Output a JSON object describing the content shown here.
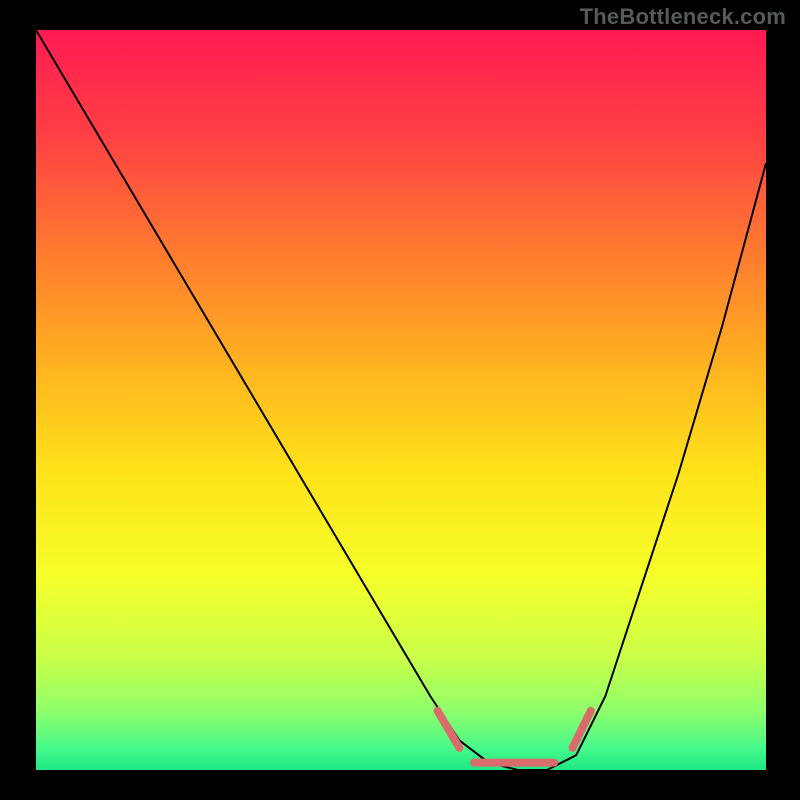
{
  "watermark": "TheBottleneck.com",
  "chart_data": {
    "type": "line",
    "title": "",
    "xlabel": "",
    "ylabel": "",
    "x_range": [
      0,
      100
    ],
    "y_range": [
      0,
      100
    ],
    "background": {
      "type": "vertical-gradient",
      "stops": [
        {
          "offset": 0.0,
          "color": "#ff1a53"
        },
        {
          "offset": 0.14,
          "color": "#ff3f44"
        },
        {
          "offset": 0.3,
          "color": "#ff7a2f"
        },
        {
          "offset": 0.46,
          "color": "#ffb520"
        },
        {
          "offset": 0.6,
          "color": "#ffe31a"
        },
        {
          "offset": 0.74,
          "color": "#f5ff2a"
        },
        {
          "offset": 0.85,
          "color": "#c9ff4a"
        },
        {
          "offset": 0.92,
          "color": "#8fff6b"
        },
        {
          "offset": 0.97,
          "color": "#48f98a"
        },
        {
          "offset": 1.0,
          "color": "#1de886"
        }
      ]
    },
    "series": [
      {
        "name": "bottleneck-curve",
        "color": "#000000",
        "stroke_width": 2,
        "x": [
          0,
          6,
          12,
          18,
          24,
          30,
          36,
          42,
          48,
          54,
          58,
          62,
          66,
          70,
          74,
          78,
          82,
          88,
          94,
          100
        ],
        "values": [
          100,
          90,
          80,
          70,
          60,
          50,
          40,
          30,
          20,
          10,
          4,
          1,
          0,
          0,
          2,
          10,
          22,
          40,
          60,
          82
        ]
      }
    ],
    "highlights": [
      {
        "name": "sweet-spot-marker",
        "color": "#d96b6d",
        "stroke_width": 8,
        "linecap": "round",
        "segments": [
          {
            "x": [
              55,
              58
            ],
            "values": [
              8,
              3
            ]
          },
          {
            "x": [
              60,
              71
            ],
            "values": [
              1,
              1
            ]
          },
          {
            "x": [
              73.5,
              76
            ],
            "values": [
              3,
              8
            ]
          }
        ]
      }
    ]
  }
}
